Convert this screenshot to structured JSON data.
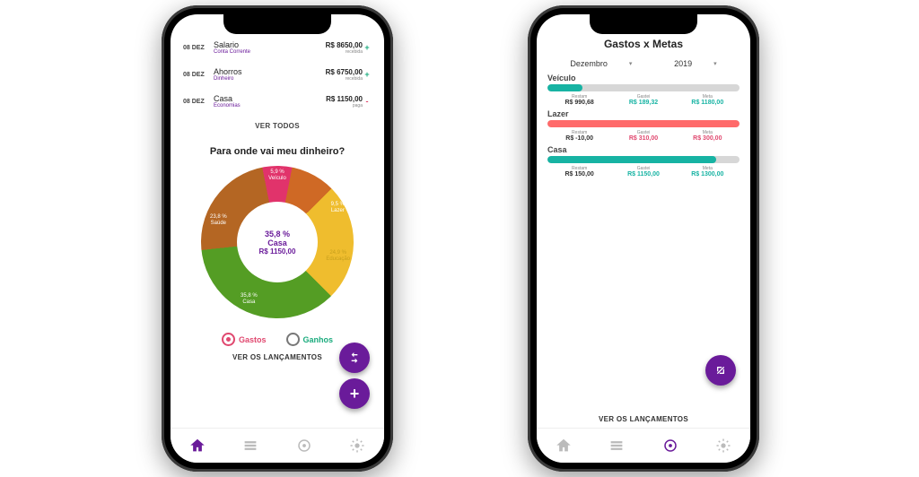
{
  "colors": {
    "purple": "#6a1b9a",
    "teal": "#17b3a3",
    "red": "#e0486f"
  },
  "left": {
    "transactions": [
      {
        "date": "08 DEZ",
        "title": "Salario",
        "subtitle": "Conta Corrente",
        "amount": "R$ 8650,00",
        "status": "recebida",
        "sign": "+"
      },
      {
        "date": "08 DEZ",
        "title": "Ahorros",
        "subtitle": "Dinheiro",
        "amount": "R$ 6750,00",
        "status": "recebida",
        "sign": "+"
      },
      {
        "date": "08 DEZ",
        "title": "Casa",
        "subtitle": "Economias",
        "amount": "R$ 1150,00",
        "status": "paga",
        "sign": "-"
      }
    ],
    "see_all": "VER TODOS",
    "section_title": "Para onde vai meu dinheiro?",
    "donut_center": {
      "pct": "35,8 %",
      "label": "Casa",
      "value": "R$ 1150,00"
    },
    "legend": {
      "gastos": "Gastos",
      "ganhos": "Ganhos"
    },
    "see_launch": "VER OS LANÇAMENTOS"
  },
  "chart_data": {
    "type": "pie",
    "title": "Para onde vai meu dinheiro?",
    "categories": [
      "Veículo",
      "Lazer",
      "Educação",
      "Casa",
      "Saúde"
    ],
    "values_pct": [
      5.9,
      9.5,
      24.9,
      35.8,
      23.8
    ],
    "center": {
      "category": "Casa",
      "value_brl": 1150.0,
      "pct": 35.8
    },
    "slice_labels": [
      {
        "name": "Veículo",
        "text": "5,9 %\nVeículo"
      },
      {
        "name": "Lazer",
        "text": "9,5 %\nLazer"
      },
      {
        "name": "Educação",
        "text": "24,9 %\nEducação"
      },
      {
        "name": "Casa",
        "text": "35,8 %\nCasa"
      },
      {
        "name": "Saúde",
        "text": "23,8 %\nSaúde"
      }
    ],
    "slice_colors": [
      "#e1336b",
      "#cf6925",
      "#efbd2e",
      "#549d24",
      "#b46623"
    ]
  },
  "right": {
    "title": "Gastos x Metas",
    "month": "Dezembro",
    "year": "2019",
    "goals": [
      {
        "name": "Veículo",
        "fill_pct": 18,
        "fill_color": "#17b3a3",
        "cols": {
          "restam_hdr": "Restam",
          "restam_val": "R$ 990,68",
          "gastei_hdr": "Gastei",
          "gastei_val": "R$ 189,32",
          "meta_hdr": "Meta",
          "meta_val": "R$ 1180,00"
        },
        "value_classes": [
          "c-dark",
          "c-teal",
          "c-teal"
        ]
      },
      {
        "name": "Lazer",
        "fill_pct": 100,
        "fill_color": "#ff6a6a",
        "cols": {
          "restam_hdr": "Restam",
          "restam_val": "R$ -10,00",
          "gastei_hdr": "Gastei",
          "gastei_val": "R$ 310,00",
          "meta_hdr": "Meta",
          "meta_val": "R$ 300,00"
        },
        "value_classes": [
          "c-dark",
          "c-red",
          "c-red"
        ]
      },
      {
        "name": "Casa",
        "fill_pct": 88,
        "fill_color": "#17b3a3",
        "cols": {
          "restam_hdr": "Restam",
          "restam_val": "R$ 150,00",
          "gastei_hdr": "Gastei",
          "gastei_val": "R$ 1150,00",
          "meta_hdr": "Meta",
          "meta_val": "R$ 1300,00"
        },
        "value_classes": [
          "c-dark",
          "c-teal",
          "c-teal"
        ]
      }
    ],
    "see_launch": "VER OS LANÇAMENTOS"
  },
  "tabbar": {
    "items": [
      "home",
      "list",
      "target",
      "settings"
    ],
    "left_active": 0,
    "right_active": 2
  }
}
